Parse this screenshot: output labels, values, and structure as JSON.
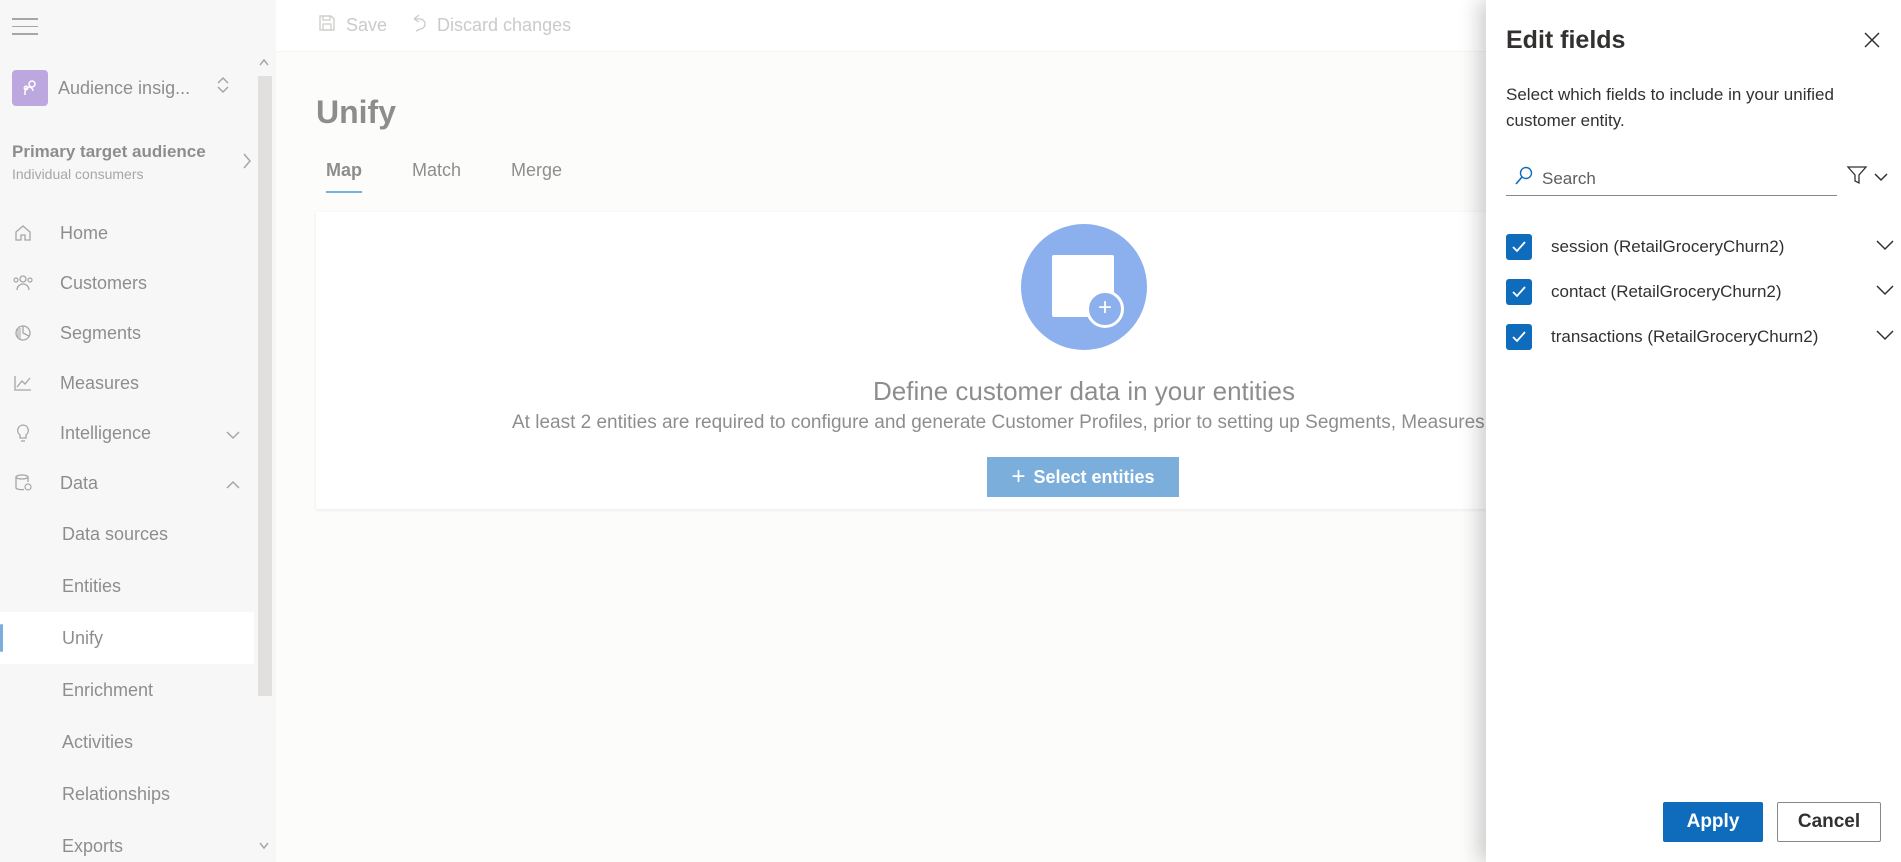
{
  "app": {
    "name": "Audience insig..."
  },
  "audience": {
    "title": "Primary target audience",
    "subtitle": "Individual consumers"
  },
  "sidebar": {
    "items": [
      {
        "label": "Home",
        "icon": "home-icon"
      },
      {
        "label": "Customers",
        "icon": "customers-icon"
      },
      {
        "label": "Segments",
        "icon": "segments-icon"
      },
      {
        "label": "Measures",
        "icon": "measures-icon"
      },
      {
        "label": "Intelligence",
        "icon": "lightbulb-icon"
      },
      {
        "label": "Data",
        "icon": "database-icon"
      }
    ],
    "data_children": [
      {
        "label": "Data sources"
      },
      {
        "label": "Entities"
      },
      {
        "label": "Unify"
      },
      {
        "label": "Enrichment"
      },
      {
        "label": "Activities"
      },
      {
        "label": "Relationships"
      },
      {
        "label": "Exports"
      }
    ]
  },
  "toolbar": {
    "save_label": "Save",
    "discard_label": "Discard changes"
  },
  "main": {
    "title": "Unify",
    "tabs": [
      {
        "label": "Map"
      },
      {
        "label": "Match"
      },
      {
        "label": "Merge"
      }
    ],
    "card": {
      "title": "Define customer data in your entities",
      "description": "At least 2 entities are required to configure and generate Customer Profiles, prior to setting up Segments, Measures and Intelligence.",
      "button_label": "Select entities"
    }
  },
  "panel": {
    "title": "Edit fields",
    "description": "Select which fields to include in your unified customer entity.",
    "search_placeholder": "Search",
    "fields": [
      {
        "label": "session (RetailGroceryChurn2)",
        "checked": true
      },
      {
        "label": "contact (RetailGroceryChurn2)",
        "checked": true
      },
      {
        "label": "transactions (RetailGroceryChurn2)",
        "checked": true
      }
    ],
    "apply_label": "Apply",
    "cancel_label": "Cancel"
  },
  "colors": {
    "accent": "#0f6cbd",
    "app_icon": "#8661c5",
    "sidebar_bg": "#f0f0f0"
  }
}
